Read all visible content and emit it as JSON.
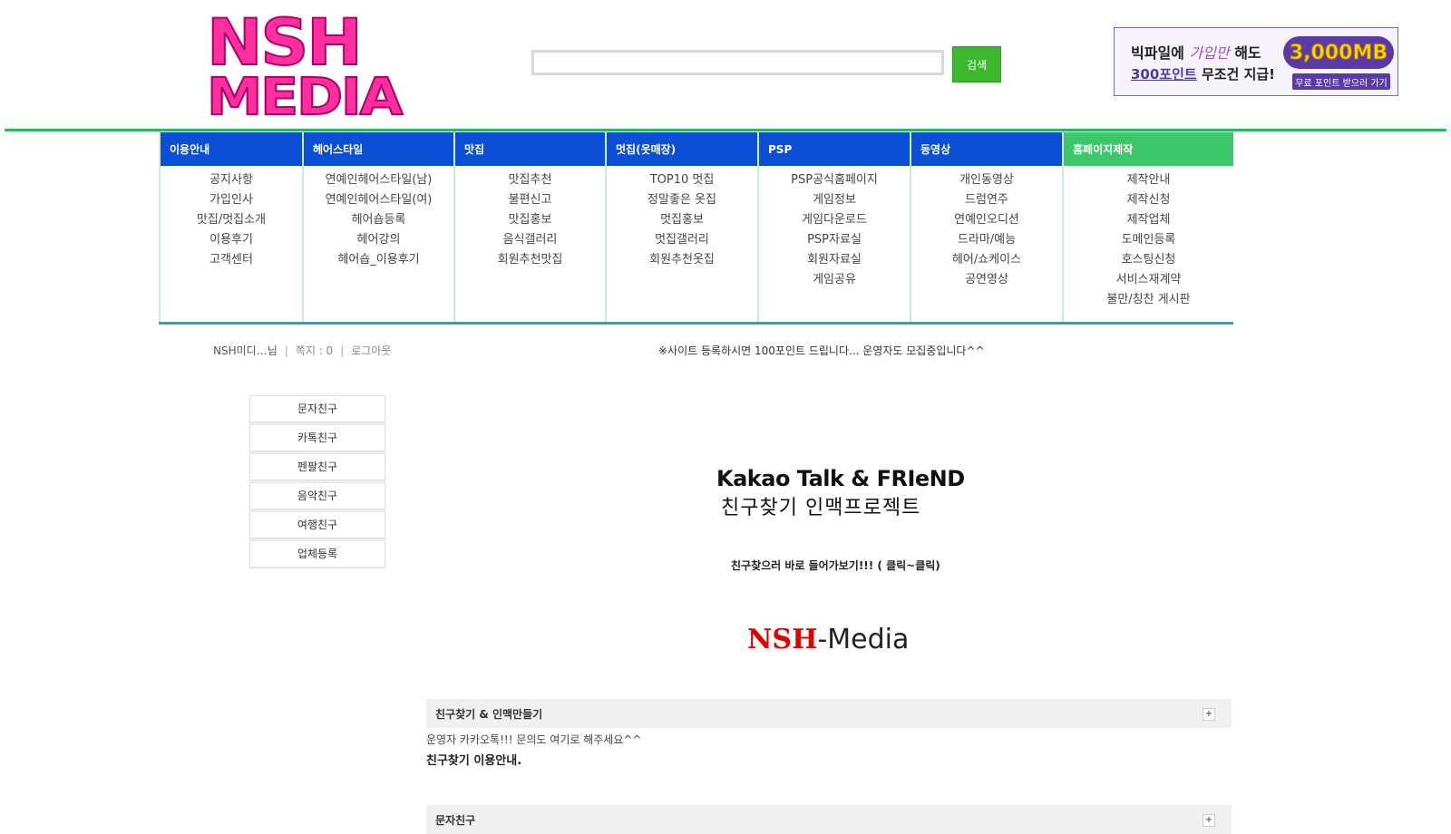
{
  "logo": {
    "line1": "NSH",
    "line2": "MEDIA"
  },
  "search": {
    "button_label": "검색",
    "value": ""
  },
  "banner": {
    "line1_prefix": "빅파일에 ",
    "line1_highlight": "가입만",
    "line1_suffix": " 해도",
    "line2_points": "300포인트",
    "line2_suffix": " 무조건 지급!",
    "big_text": "3,000MB",
    "small_text": "무료 포인트 받으러 가기"
  },
  "nav": [
    {
      "label": "이용안내",
      "items": [
        "공지사항",
        "가입인사",
        "맛집/멋집소개",
        "이용후기",
        "고객센터"
      ]
    },
    {
      "label": "헤어스타일",
      "items": [
        "연예인헤어스타일(남)",
        "연예인헤어스타일(여)",
        "헤어숍등록",
        "헤어강의",
        "헤어숍_이용후기"
      ]
    },
    {
      "label": "맛집",
      "items": [
        "맛집추천",
        "불편신고",
        "맛집홍보",
        "음식갤러리",
        "회원추천맛집"
      ]
    },
    {
      "label": "멋집(옷매장)",
      "items": [
        "TOP10 멋집",
        "정말좋은 옷집",
        "멋집홍보",
        "멋집갤러리",
        "회원추천옷집"
      ]
    },
    {
      "label": "PSP",
      "items": [
        "PSP공식홈페이지",
        "게임정보",
        "게임다운로드",
        "PSP자료실",
        "회원자료실",
        "게임공유"
      ]
    },
    {
      "label": "동영상",
      "items": [
        "개인동영상",
        "드럼연주",
        "연예인오디션",
        "드라마/예능",
        "헤어/쇼케이스",
        "공연영상"
      ]
    },
    {
      "label": "홈페이지제작",
      "items": [
        "제작안내",
        "제작신청",
        "제작업체",
        "도메인등록",
        "호스팅신청",
        "서비스재계약",
        "불만/칭찬 게시판"
      ]
    }
  ],
  "status": {
    "user": "NSH미디…님",
    "memo": "쪽지 : 0",
    "logout": "로그아웃",
    "sep": "|"
  },
  "notice": "※사이트 등록하시면 100포인트 드립니다... 운영자도 모집중입니다^^",
  "side_menu": [
    "문자친구",
    "카톡친구",
    "펜팔친구",
    "음악친구",
    "여행친구",
    "업체등록"
  ],
  "main": {
    "title": "Kakao Talk & FRIeND",
    "subtitle": "친구찾기 인맥프로젝트",
    "link": "친구찾으러 바로 들어가보기!!! ( 클릭~클릭)",
    "brand_red": "NSH",
    "brand_rest": "-Media"
  },
  "panels": [
    {
      "title": "친구찾기 & 인맥만들기",
      "items": [
        "운영자 카카오톡!!! 문의도 여기로 해주세요^^",
        "친구찾기 이용안내."
      ]
    },
    {
      "title": "문자친구"
    }
  ],
  "plus": "+"
}
